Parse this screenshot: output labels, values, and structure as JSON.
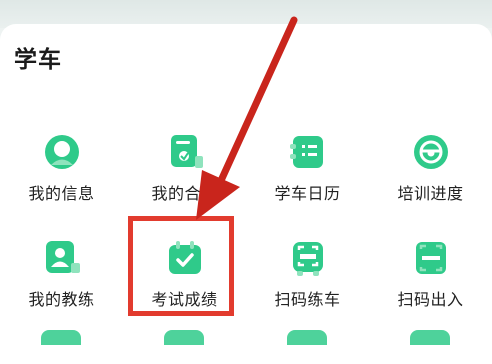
{
  "section": {
    "title": "学车"
  },
  "items": [
    {
      "label": "我的信息",
      "icon": "person-icon"
    },
    {
      "label": "我的合同",
      "icon": "contract-icon"
    },
    {
      "label": "学车日历",
      "icon": "calendar-icon"
    },
    {
      "label": "培训进度",
      "icon": "steering-wheel-icon"
    },
    {
      "label": "我的教练",
      "icon": "coach-icon"
    },
    {
      "label": "考试成绩",
      "icon": "exam-score-icon"
    },
    {
      "label": "扫码练车",
      "icon": "scan-car-icon"
    },
    {
      "label": "扫码出入",
      "icon": "scan-door-icon"
    }
  ],
  "colors": {
    "icon_green": "#2fca8a",
    "icon_light": "#8fe3bd",
    "annotation_red": "#e23b2e"
  }
}
